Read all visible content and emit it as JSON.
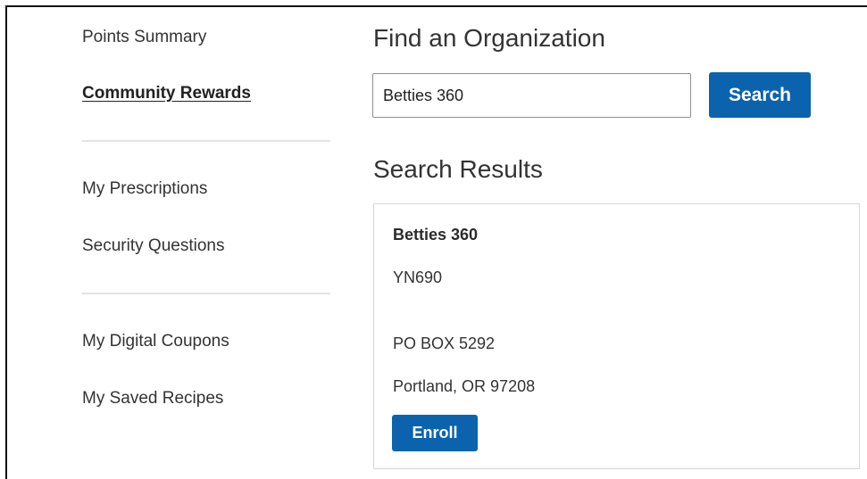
{
  "sidebar": {
    "group1": {
      "points_summary": "Points Summary",
      "community_rewards": "Community Rewards"
    },
    "group2": {
      "my_prescriptions": "My Prescriptions",
      "security_questions": "Security Questions"
    },
    "group3": {
      "my_digital_coupons": "My Digital Coupons",
      "my_saved_recipes": "My Saved Recipes"
    },
    "active_item": "Community Rewards"
  },
  "main": {
    "title": "Find an Organization",
    "search": {
      "value": "Betties 360",
      "button_label": "Search"
    },
    "results_heading": "Search Results",
    "results": [
      {
        "name": "Betties 360",
        "code": "YN690",
        "address_line1": "PO BOX 5292",
        "address_line2": "Portland, OR 97208",
        "enroll_label": "Enroll"
      }
    ]
  },
  "colors": {
    "primary_button": "#0b63ae",
    "text": "#333333",
    "divider": "#e3e3e3",
    "card_border": "#d6d6d6"
  }
}
